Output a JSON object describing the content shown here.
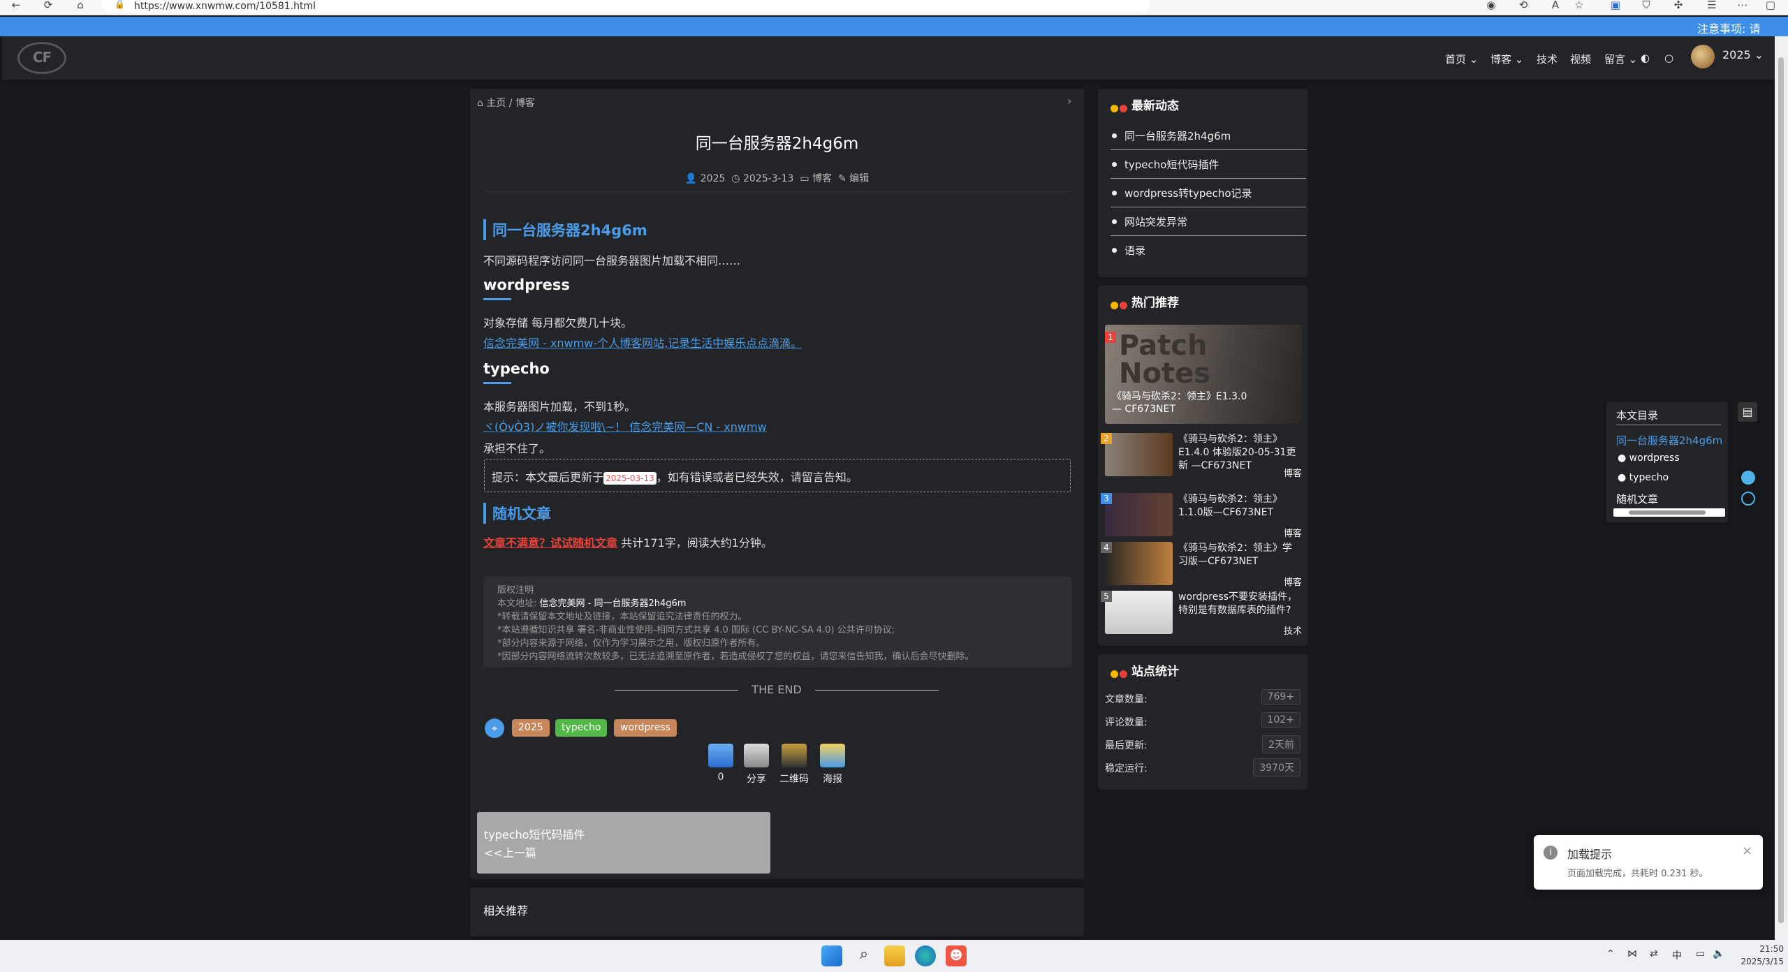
{
  "browser": {
    "url": "https://www.xnwmw.com/10581.html"
  },
  "notice": {
    "text": "注意事项: 请"
  },
  "header": {
    "logo": "CF",
    "nav": [
      "首页",
      "博客",
      "技术",
      "视频",
      "留言"
    ],
    "user": "2025"
  },
  "article": {
    "breadcrumb_home": "主页",
    "breadcrumb_sep": "/",
    "breadcrumb_cat": "博客",
    "title": "同一台服务器2h4g6m",
    "meta_author": "2025",
    "meta_date": "2025-3-13",
    "meta_cat": "博客",
    "meta_edit": "编辑",
    "h1": "同一台服务器2h4g6m",
    "intro": "不同源码程序访问同一台服务器图片加载不相同……",
    "sec1_title": "wordpress",
    "sec1_text": "对象存储 每月都欠费几十块。",
    "sec1_link": "信念完美网 - xnwmw-个人博客网站,记录生活中娱乐点点滴滴。",
    "sec2_title": "typecho",
    "sec2_text": "本服务器图片加载，不到1秒。",
    "sec2_link": "ヾ(ÓvÒ3)ノ被你发现啦\\~！ 信念完美网—CN - xnwmw",
    "sec2_text2": "承担不住了。",
    "tip_prefix": "提示：本文最后更新于",
    "tip_date": "2025-03-13",
    "tip_suffix": "，如有错误或者已经失效，请留言告知。",
    "random_title": "随机文章",
    "random_link": "文章不满意？试试随机文章",
    "random_stats": "共计171字，阅读大约1分钟。",
    "copyright_head": "版权注明",
    "copyright_addr_label": "本文地址:",
    "copyright_addr": "信念完美网 - 同一台服务器2h4g6m",
    "copyright_l1": "*转载请保留本文地址及链接，本站保留追究法律责任的权力。",
    "copyright_l2": "*本站遵循知识共享 署名-非商业性使用-相同方式共享 4.0 国际 (CC BY-NC-SA 4.0) 公共许可协议;",
    "copyright_l3": "*部分内容来源于网络，仅作为学习展示之用，版权归原作者所有。",
    "copyright_l4": "*因部分内容网络流转次数较多，已无法追溯至原作者，若造成侵权了您的权益，请您来信告知我，确认后会尽快删除。",
    "the_end": "THE END",
    "tags": [
      "2025",
      "typecho",
      "wordpress"
    ],
    "tag_colors": [
      "#c8875a",
      "#52b948",
      "#c8875a"
    ],
    "actions": [
      "0",
      "分享",
      "二维码",
      "海报"
    ],
    "prev_title": "typecho短代码插件",
    "prev_label": "<<上一篇",
    "related": "相关推荐"
  },
  "sidebar": {
    "latest_title": "最新动态",
    "latest": [
      "同一台服务器2h4g6m",
      "typecho短代码插件",
      "wordpress转typecho记录",
      "网站突发异常",
      "语录"
    ],
    "hot_title": "热门推荐",
    "hot_banner_text": "Patch Notes",
    "hot_banner_caption": "《骑马与砍杀2：领主》E1.3.0 — CF673NET",
    "hot": [
      {
        "rank": "2",
        "title": "《骑马与砍杀2：领主》E1.4.0 体验版20-05-31更新 —CF673NET",
        "cat": "博客",
        "color": "#e8a32a"
      },
      {
        "rank": "3",
        "title": "《骑马与砍杀2：领主》1.1.0版—CF673NET",
        "cat": "博客",
        "color": "#3d8fe8"
      },
      {
        "rank": "4",
        "title": "《骑马与砍杀2：领主》学习版—CF673NET",
        "cat": "博客",
        "color": "#666666"
      },
      {
        "rank": "5",
        "title": "wordpress不要安装插件，特别是有数据库表的插件?",
        "cat": "技术",
        "color": "#666666"
      }
    ],
    "stats_title": "站点统计",
    "stats": [
      {
        "label": "文章数量:",
        "value": "769+"
      },
      {
        "label": "评论数量:",
        "value": "102+"
      },
      {
        "label": "最后更新:",
        "value": "2天前"
      },
      {
        "label": "稳定运行:",
        "value": "3970天"
      }
    ]
  },
  "toc": {
    "title": "本文目录",
    "items": [
      "同一台服务器2h4g6m",
      "wordpress",
      "typecho",
      "随机文章"
    ]
  },
  "toast": {
    "title": "加载提示",
    "body": "页面加载完成，共耗时 0.231 秒。"
  },
  "taskbar": {
    "time": "21:50",
    "date": "2025/3/15",
    "ime": "中"
  }
}
